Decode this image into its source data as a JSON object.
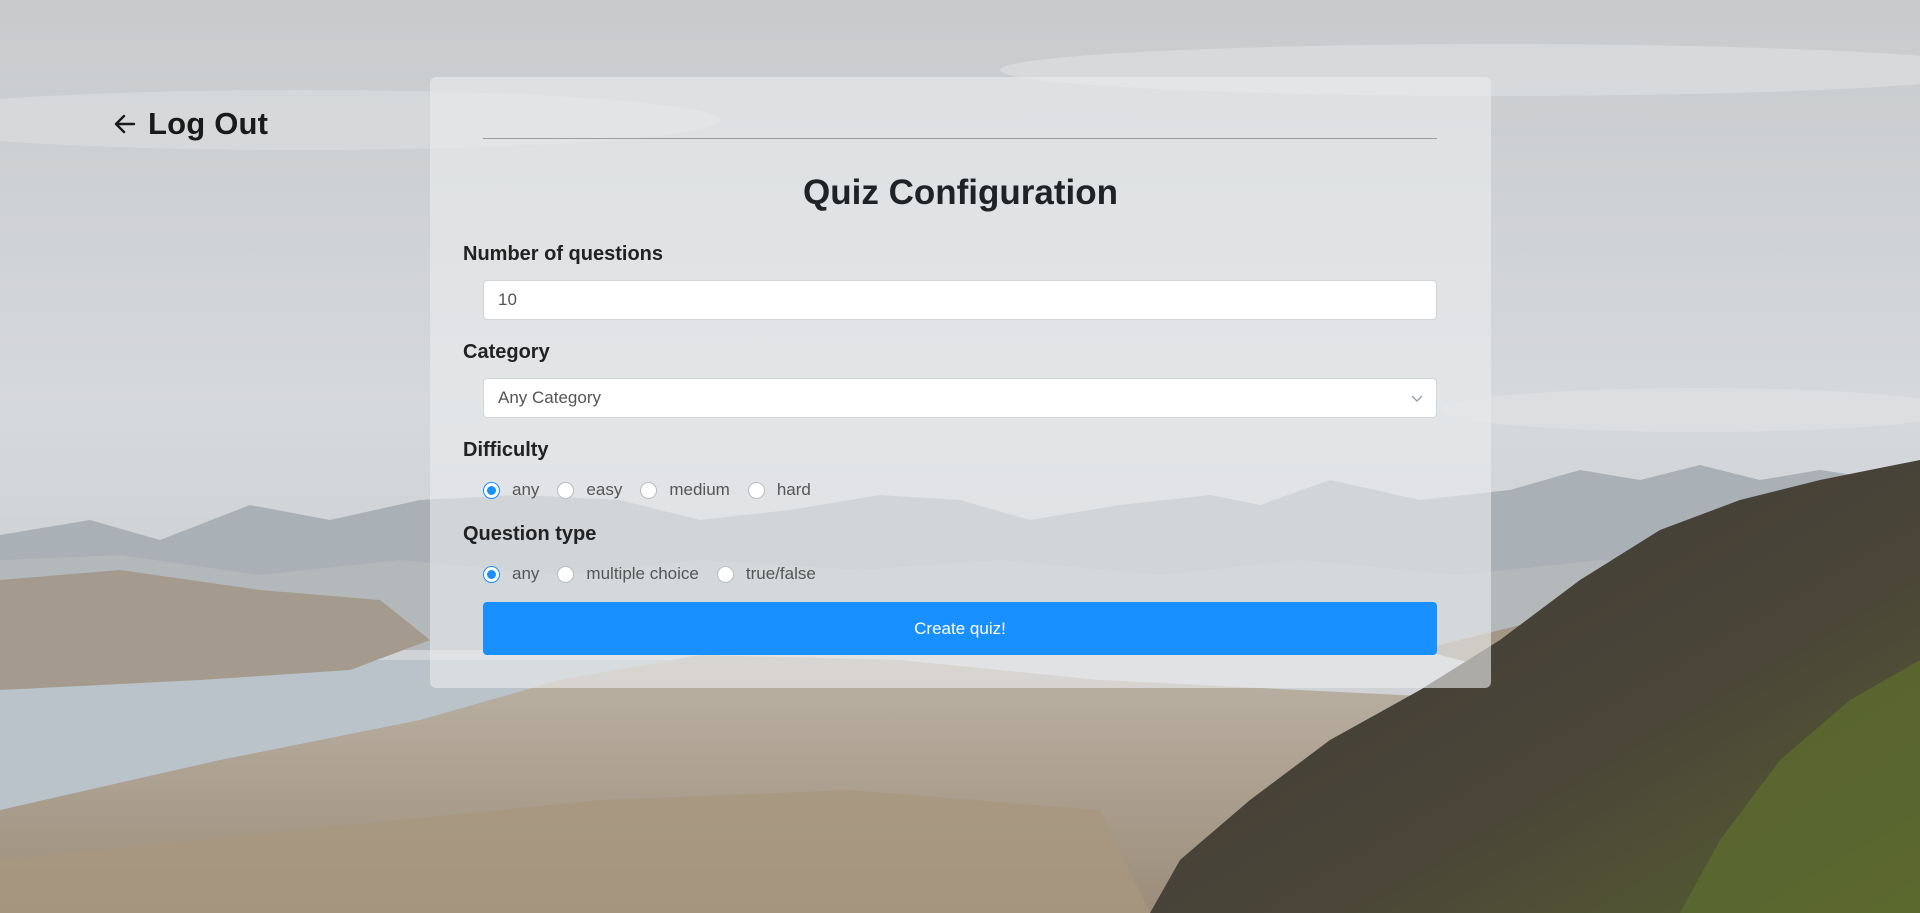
{
  "nav": {
    "logout_label": "Log Out"
  },
  "form": {
    "title": "Quiz Configuration",
    "questions": {
      "label": "Number of questions",
      "value": "10"
    },
    "category": {
      "label": "Category",
      "selected": "Any Category"
    },
    "difficulty": {
      "label": "Difficulty",
      "options": [
        "any",
        "easy",
        "medium",
        "hard"
      ],
      "selected": "any"
    },
    "question_type": {
      "label": "Question type",
      "options": [
        "any",
        "multiple choice",
        "true/false"
      ],
      "selected": "any"
    },
    "submit_label": "Create quiz!"
  },
  "colors": {
    "accent": "#1890ff"
  },
  "icons": {
    "logout": "arrow-left-icon",
    "select": "chevron-down-icon"
  }
}
